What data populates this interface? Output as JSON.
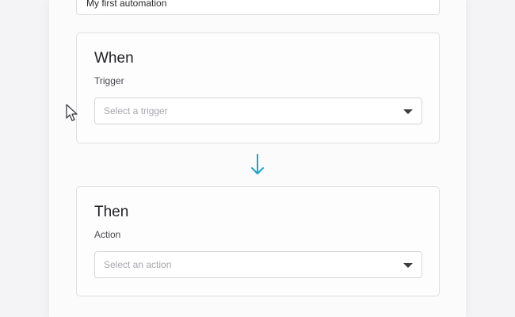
{
  "automation": {
    "name_value": "My first automation"
  },
  "when_block": {
    "title": "When",
    "field_label": "Trigger",
    "select_placeholder": "Select a trigger"
  },
  "then_block": {
    "title": "Then",
    "field_label": "Action",
    "select_placeholder": "Select an action"
  },
  "icons": {
    "flow_arrow": "arrow-down-icon",
    "dropdown_caret": "chevron-down-icon",
    "pointer": "mouse-cursor-icon"
  },
  "colors": {
    "accent": "#1ba2c8"
  }
}
